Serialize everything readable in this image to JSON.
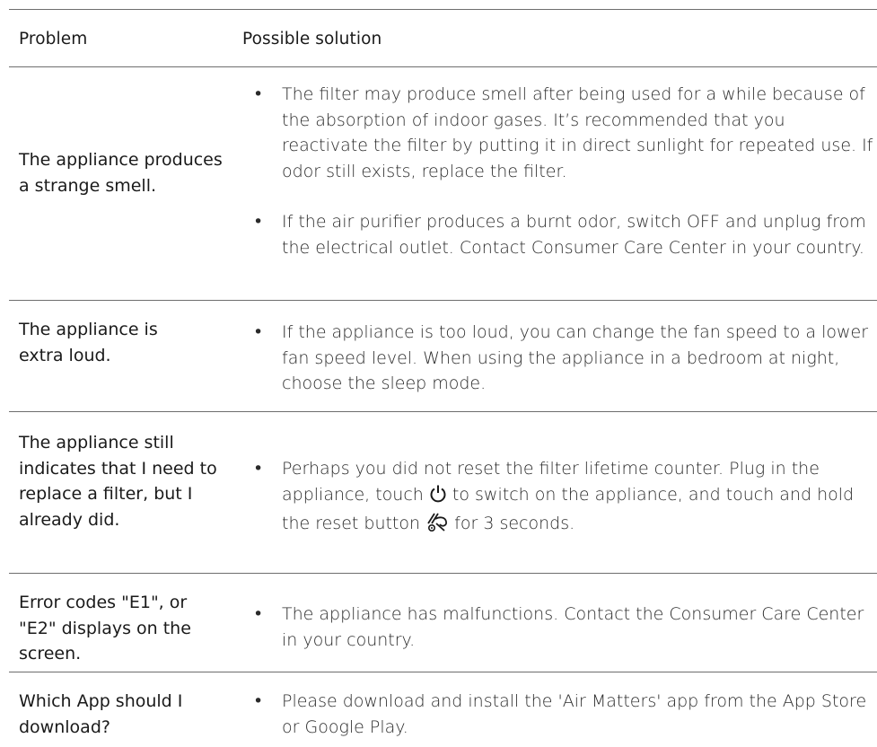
{
  "header": {
    "problem": "Problem",
    "solution": "Possible solution"
  },
  "rows": [
    {
      "problem": "The appliance produces a strange smell.",
      "solutions": [
        "The filter may produce smell after being used for a while because of the absorption of indoor gases. It’s recommended that you reactivate the filter by putting it in direct sunlight for repeated use. If odor still exists, replace the filter.",
        "If the air purifier produces a burnt odor, switch OFF and unplug from the electrical outlet. Contact Consumer Care Center in your country."
      ]
    },
    {
      "problem": "The appliance is extra loud.",
      "solutions": [
        "If the appliance is too loud, you can change the fan speed to a lower fan speed level. When using the appliance in a bedroom at night, choose the sleep mode."
      ]
    },
    {
      "problem": "The appliance still indicates that I need to replace a filter, but I already did.",
      "solution_parts": {
        "part1": "Perhaps you did not reset the filter lifetime counter. Plug in the appliance, touch",
        "part2": "to switch on the appliance, and touch and hold the reset button",
        "part3": "for 3 seconds."
      },
      "icons": [
        "power-icon",
        "filter-reset-icon"
      ]
    },
    {
      "problem": "Error codes \"E1\", or \"E2\" displays on the screen.",
      "solutions": [
        "The appliance has malfunctions. Contact the Consumer Care Center in your country."
      ]
    },
    {
      "problem": "Which App should I download?",
      "solutions": [
        "Please download and install the 'Air Matters' app from the App Store or Google Play."
      ]
    }
  ],
  "bullet": "•"
}
